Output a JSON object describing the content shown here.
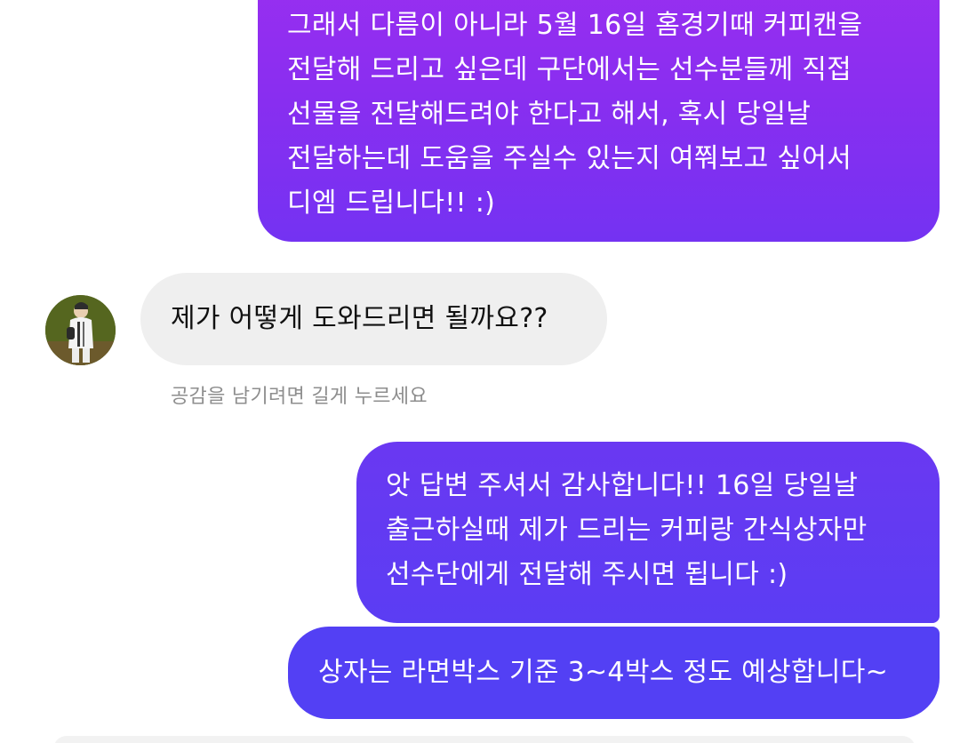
{
  "messages": {
    "sent_1": {
      "lines": [
        "그래서 다름이 아니라 5월 16일 홈경기때 커피캔을",
        "전달해 드리고 싶은데 구단에서는 선수분들께 직접",
        "선물을 전달해드려야 한다고 해서, 혹시 당일날",
        "전달하는데 도움을 주실수 있는지 여쭤보고 싶어서",
        "디엠 드립니다!! :)"
      ]
    },
    "received_1": {
      "text": "제가 어떻게 도와드리면 될까요??"
    },
    "reaction_hint": "공감을 남기려면 길게 누르세요",
    "sent_2": {
      "lines": [
        "앗 답변 주셔서 감사합니다!! 16일 당일날",
        "출근하실때 제가 드리는 커피랑 간식상자만",
        "선수단에게 전달해 주시면 됩니다 :)"
      ]
    },
    "sent_3": {
      "text": "상자는 라면박스 기준 3~4박스 정도 예상합니다~"
    }
  },
  "colors": {
    "sent_gradient_top": "#9a2ff0",
    "sent_gradient_bottom": "#5340f4",
    "received_bubble": "#efefef",
    "hint_text": "#8e8e8e"
  },
  "icons": {
    "avatar": "profile-photo"
  }
}
